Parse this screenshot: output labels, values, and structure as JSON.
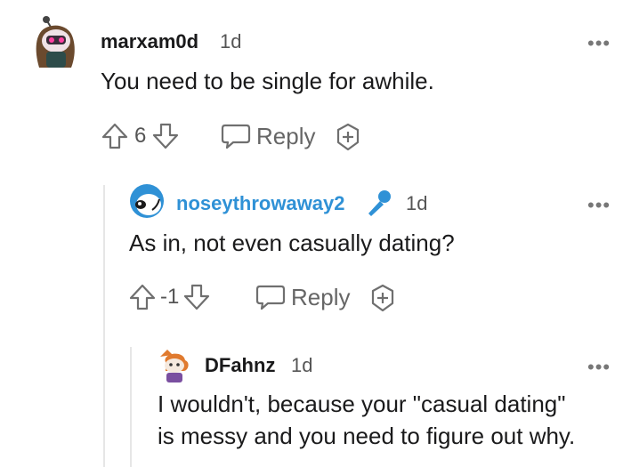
{
  "comments": [
    {
      "username": "marxam0d",
      "age": "1d",
      "body": "You need to be single for awhile.",
      "score": "6",
      "reply_label": "Reply",
      "avatar_icon": "snoo-avatar-icon",
      "username_color": "#1a1a1b"
    },
    {
      "username": "noseythrowaway2",
      "age": "1d",
      "body": "As in, not even casually dating?",
      "score": "-1",
      "reply_label": "Reply",
      "avatar_icon": "snoo-avatar-icon",
      "badge_icon": "microphone-icon",
      "username_color": "#2f91d6"
    },
    {
      "username": "DFahnz",
      "age": "1d",
      "body_line1": "I wouldn't, because your \"casual dating\"",
      "body_line2": "is messy and you need to figure out why.",
      "avatar_icon": "snoo-avatar-icon",
      "username_color": "#1a1a1b"
    }
  ],
  "more_label": "•••",
  "colors": {
    "accent": "#2f91d6",
    "icon_gray": "#6f6f6f"
  }
}
